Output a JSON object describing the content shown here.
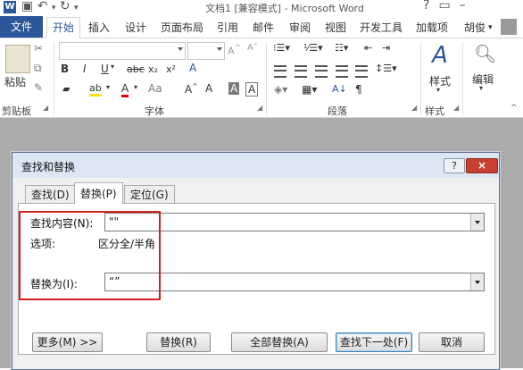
{
  "window": {
    "title": "文档1 [兼容模式] - Microsoft Word",
    "app_icon": "W"
  },
  "ribbon": {
    "tabs": [
      "文件",
      "开始",
      "插入",
      "设计",
      "页面布局",
      "引用",
      "邮件",
      "审阅",
      "视图",
      "开发工具",
      "加载项",
      "胡俊"
    ],
    "active_tab": "开始",
    "groups": {
      "clipboard": {
        "paste": "粘贴",
        "label": "剪贴板"
      },
      "font": {
        "label": "字体",
        "font_name": "",
        "font_size": ""
      },
      "paragraph": {
        "label": "段落"
      },
      "styles": {
        "button": "样式",
        "label": "样式"
      },
      "editing": {
        "button": "编辑"
      }
    }
  },
  "dialog": {
    "title": "查找和替换",
    "help": "?",
    "close": "×",
    "tabs": [
      {
        "label": "查找(D)"
      },
      {
        "label": "替换(P)"
      },
      {
        "label": "定位(G)"
      }
    ],
    "active_tab": "替换(P)",
    "find_label": "查找内容(N):",
    "find_value": "\"\"",
    "options_label": "选项:",
    "options_value": "区分全/半角",
    "replace_label": "替换为(I):",
    "replace_value": "“”",
    "buttons": {
      "more": "更多(M) >>",
      "replace": "替换(R)",
      "replace_all": "全部替换(A)",
      "find_next": "查找下一处(F)",
      "cancel": "取消"
    }
  },
  "colors": {
    "word_blue": "#2b579a",
    "highlight_red": "#d32020",
    "close_red": "#c84031"
  }
}
